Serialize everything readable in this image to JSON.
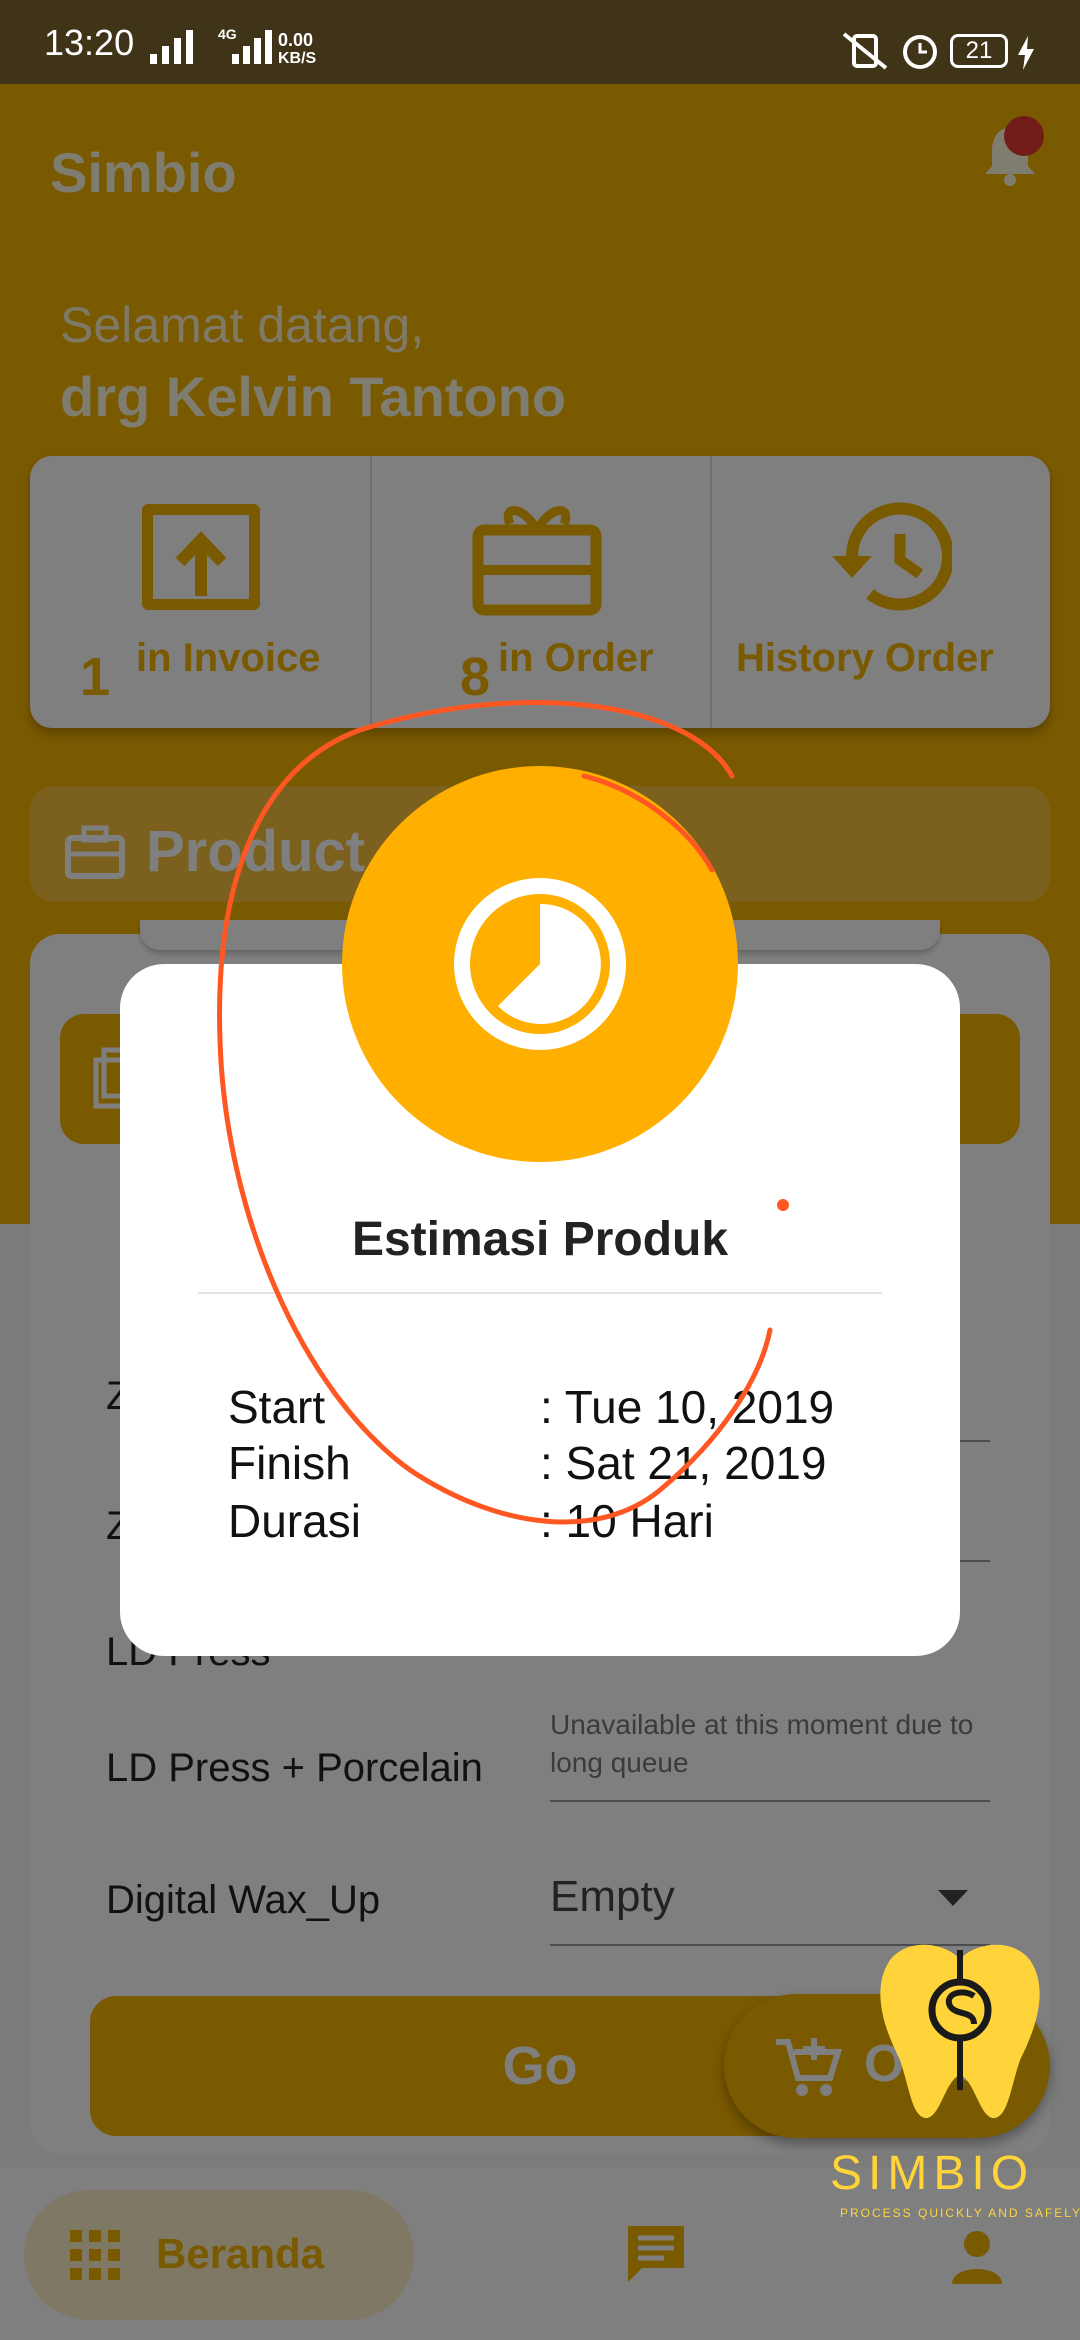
{
  "status_bar": {
    "time": "13:20",
    "net_gen": "4G",
    "speed_value": "0.00",
    "speed_unit": "KB/S",
    "battery": "21"
  },
  "app": {
    "title": "Simbio"
  },
  "greeting": {
    "line1": "Selamat datang,",
    "name": "drg Kelvin Tantono"
  },
  "summary": {
    "invoice_count": "1",
    "invoice_label": "in Invoice",
    "order_count": "8",
    "order_label": "in Order",
    "history_label": "History Order"
  },
  "product": {
    "label": "Product"
  },
  "rows": [
    {
      "label": "Z",
      "value": ""
    },
    {
      "label": "Z",
      "value": ""
    },
    {
      "label": "LD Press",
      "value": ""
    },
    {
      "label": "LD Press + Porcelain",
      "value": "Unavailable at this moment due to long queue"
    },
    {
      "label": "Digital Wax_Up",
      "value": "Empty"
    }
  ],
  "buttons": {
    "go": "Go",
    "cart": "Order"
  },
  "nav": {
    "home": "Beranda"
  },
  "dialog": {
    "title": "Estimasi Produk",
    "start_label": "Start",
    "start_value": ": Tue 10, 2019",
    "finish_label": "Finish",
    "finish_value": ": Sat 21, 2019",
    "duration_label": "Durasi",
    "duration_value": ": 10 Hari"
  },
  "watermark": {
    "brand": "SIMBIO",
    "tagline": "PROCESS QUICKLY AND SAFELY"
  },
  "colors": {
    "accent": "#f4b400",
    "dialog_icon": "#ffaf00",
    "scribble": "#ff5722",
    "notification": "#e53935"
  }
}
